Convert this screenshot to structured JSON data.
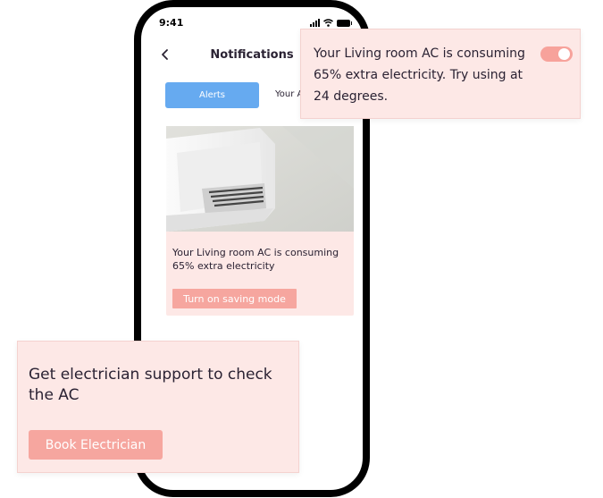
{
  "status_bar": {
    "time": "9:41",
    "icons": [
      "signal-icon",
      "wifi-icon",
      "battery-icon"
    ]
  },
  "nav": {
    "title": "Notifications",
    "back_icon": "chevron-left-icon"
  },
  "tabs": [
    {
      "label": "Alerts",
      "active": true
    },
    {
      "label": "Your Ac",
      "active": false
    }
  ],
  "alert_card": {
    "image": "air-conditioner-photo",
    "text": "Your Living room AC is consuming 65% extra electricity",
    "button_label": "Turn on saving mode"
  },
  "popup_top": {
    "text": "Your Living room AC is consuming 65% extra electricity. Try using at 24 degrees.",
    "toggle_on": true
  },
  "popup_bottom": {
    "text": "Get electrician support to check the AC",
    "button_label": "Book Electrician"
  },
  "colors": {
    "accent_blue": "#66aaf0",
    "card_pink": "#fde8e6",
    "button_salmon": "#f6a69f",
    "text_dark": "#2a2233"
  }
}
